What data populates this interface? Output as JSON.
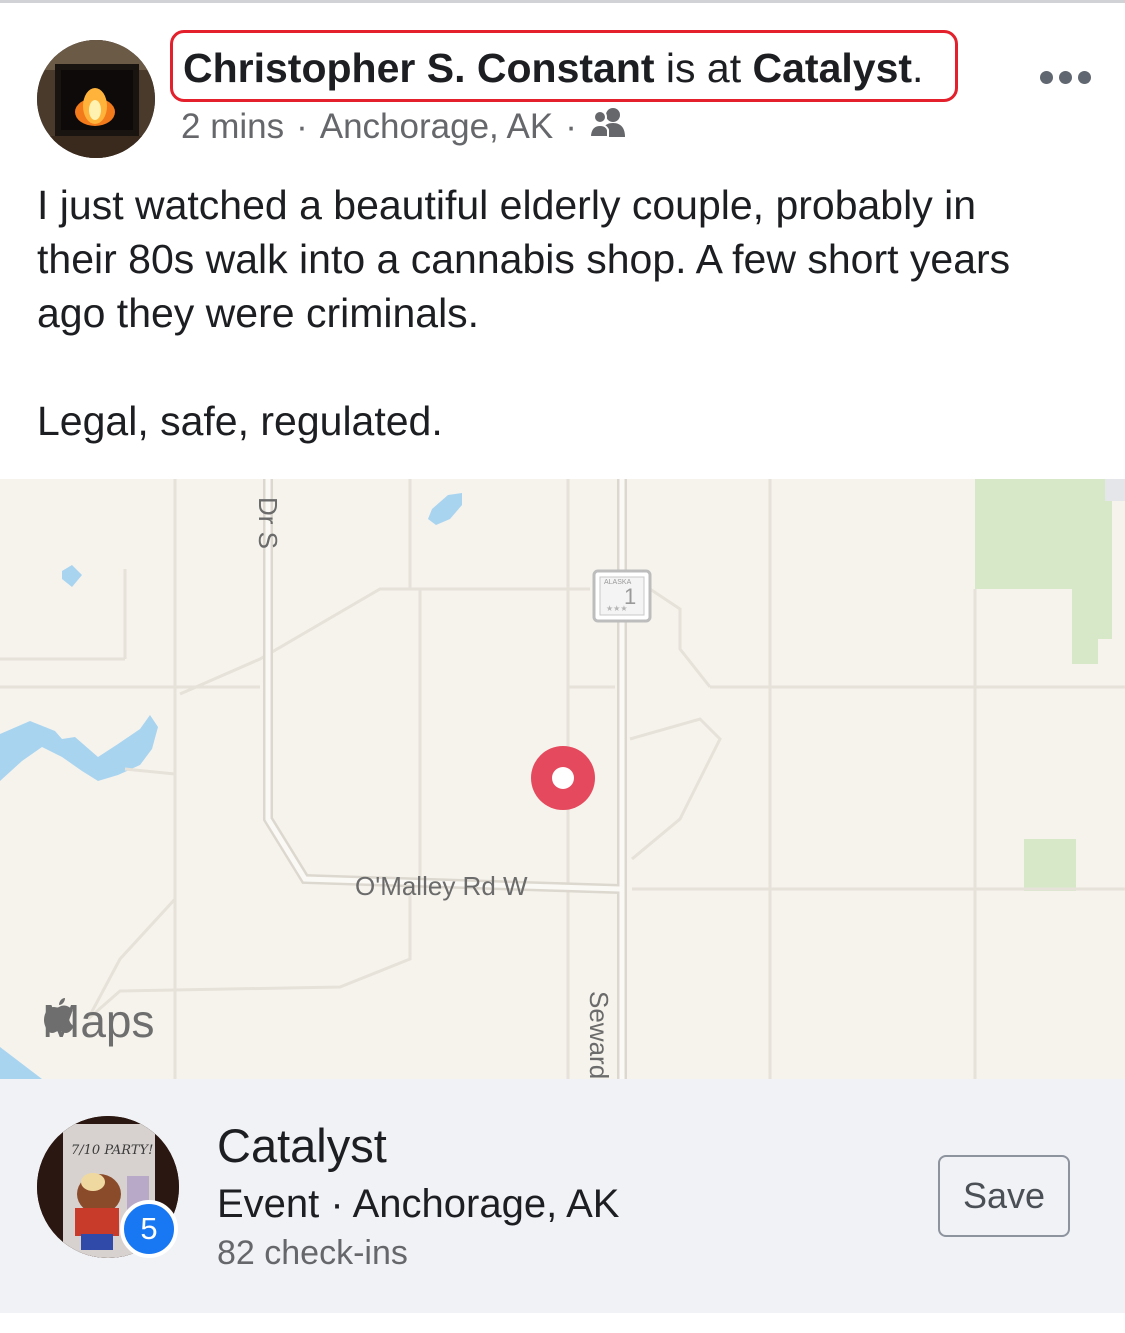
{
  "post": {
    "author": "Christopher S. Constant",
    "is_at": " is at ",
    "place": "Catalyst",
    "period": ".",
    "time": "2 mins",
    "location": "Anchorage, AK",
    "audience_icon": "friends-icon",
    "text_lines": [
      "I just watched a beautiful elderly couple, probably in",
      "their 80s walk into a cannabis shop. A few short years",
      "ago they were criminals."
    ],
    "text_line_2": "Legal, safe, regulated."
  },
  "map": {
    "road_labels": {
      "omalley": "O'Malley Rd W",
      "seward": "Seward",
      "drs": "Dr S"
    },
    "shield_text": "ALASKA",
    "shield_number": "1",
    "brand": "Maps",
    "pin_color": "#e5495d"
  },
  "place_card": {
    "name": "Catalyst",
    "subtitle": "Event · Anchorage, AK",
    "checkins": "82 check-ins",
    "badge_count": "5",
    "save_label": "Save"
  },
  "colors": {
    "highlight_box": "#e3202c",
    "link_blue": "#1877f2",
    "secondary_text": "#65676b"
  }
}
